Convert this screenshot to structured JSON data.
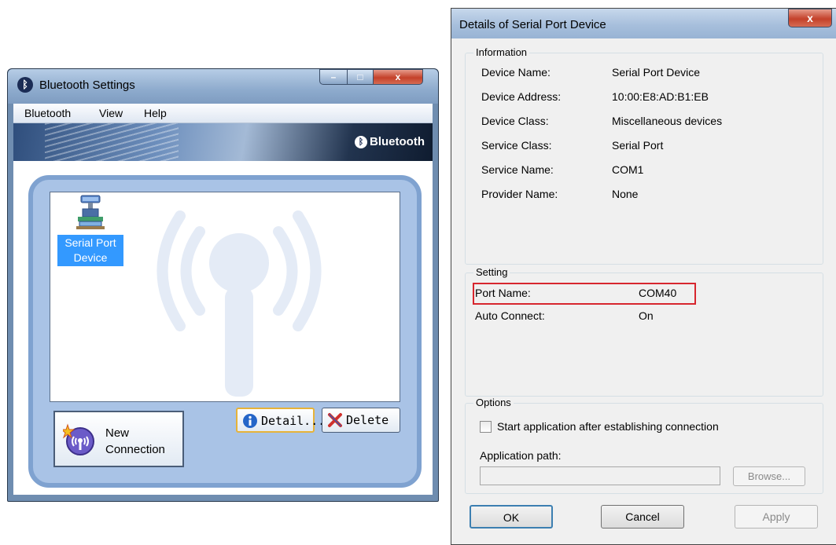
{
  "bluetooth_window": {
    "title": "Bluetooth Settings",
    "menu": [
      "Bluetooth",
      "View",
      "Help"
    ],
    "brand": "Bluetooth",
    "device": {
      "label_line1": "Serial Port",
      "label_line2": "Device",
      "icon": "serial-port-device-icon"
    },
    "buttons": {
      "new_connection_line1": "New",
      "new_connection_line2": "Connection",
      "detail": "Detail...",
      "delete": "Delete"
    },
    "caption_buttons": {
      "minimize": "–",
      "maximize": "□",
      "close": "x"
    }
  },
  "details_dialog": {
    "title": "Details of Serial Port Device",
    "close": "x",
    "information": {
      "heading": "Information",
      "rows": [
        {
          "label": "Device Name:",
          "value": "Serial Port Device"
        },
        {
          "label": "Device Address:",
          "value": "10:00:E8:AD:B1:EB"
        },
        {
          "label": "Device Class:",
          "value": "Miscellaneous devices"
        },
        {
          "label": "Service Class:",
          "value": "Serial Port"
        },
        {
          "label": "Service Name:",
          "value": "COM1"
        },
        {
          "label": "Provider Name:",
          "value": "None"
        }
      ]
    },
    "setting": {
      "heading": "Setting",
      "rows": [
        {
          "label": "Port Name:",
          "value": "COM40"
        },
        {
          "label": "Auto Connect:",
          "value": "On"
        }
      ]
    },
    "options": {
      "heading": "Options",
      "checkbox_label": "Start application after establishing connection",
      "checkbox_checked": false,
      "app_path_label": "Application path:",
      "app_path_value": "",
      "browse": "Browse..."
    },
    "buttons": {
      "ok": "OK",
      "cancel": "Cancel",
      "apply": "Apply"
    }
  },
  "colors": {
    "highlight_box": "#d7262e",
    "selection": "#3399ff"
  }
}
